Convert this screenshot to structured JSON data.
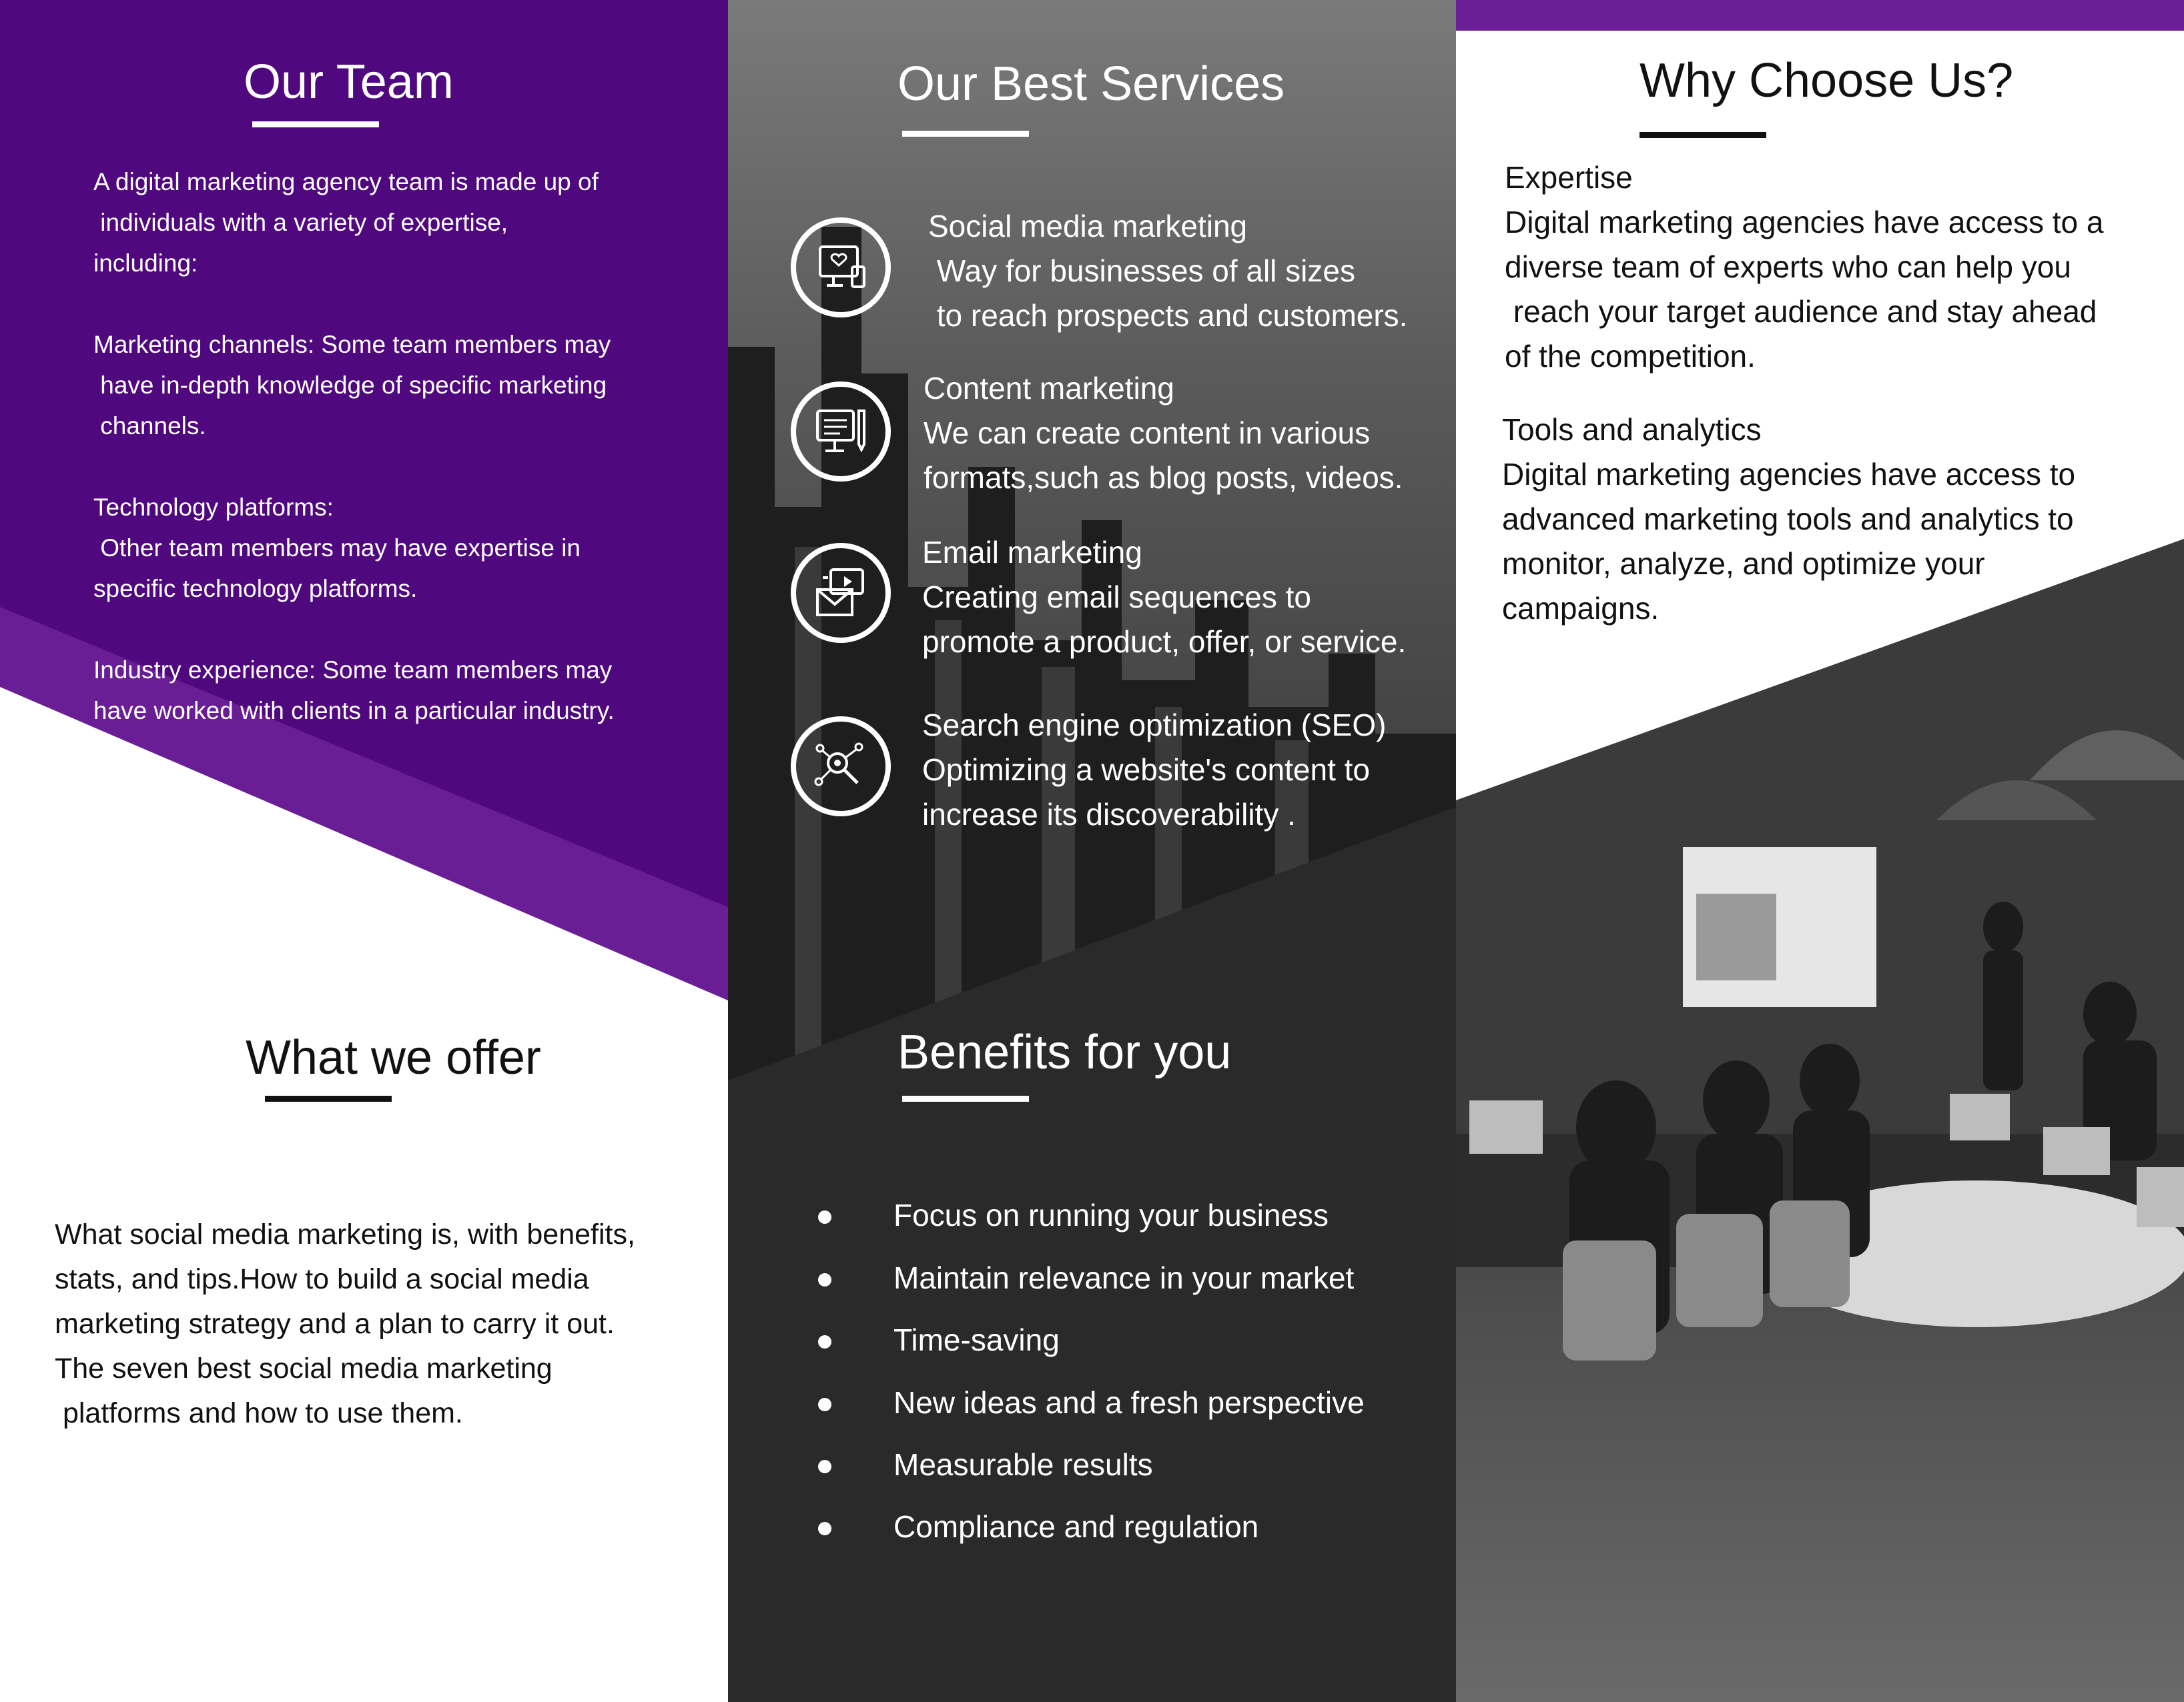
{
  "colors": {
    "purple_dark": "#4a0a7a",
    "purple_light": "#6a1e96",
    "dark_gray": "#2a2a2a",
    "accent_bar": "#6b1f96"
  },
  "team": {
    "title": "Our Team",
    "body": "A digital marketing agency team is made up of\n individuals with a variety of expertise,\nincluding:\n\nMarketing channels: Some team members may\n have in-depth knowledge of specific marketing\n channels.\n\nTechnology platforms:\n Other team members may have expertise in\nspecific technology platforms.\n\nIndustry experience: Some team members may\nhave worked with clients in a particular industry."
  },
  "offer": {
    "title": "What we offer",
    "body": "What social media marketing is, with benefits,\nstats, and tips.How to build a social media\nmarketing strategy and a plan to carry it out.\nThe seven best social media marketing\n platforms and how to use them."
  },
  "services": {
    "title": "Our Best Services",
    "items": [
      {
        "icon": "social-media-icon",
        "text": "Social media marketing\n Way for businesses of all sizes\n to reach prospects and customers."
      },
      {
        "icon": "content-marketing-icon",
        "text": "Content marketing\nWe can create content in various\nformats,such as blog posts, videos."
      },
      {
        "icon": "email-marketing-icon",
        "text": "Email marketing\nCreating email sequences to\npromote a product, offer, or service."
      },
      {
        "icon": "seo-icon",
        "text": "Search engine optimization (SEO)\nOptimizing a website's content to\nincrease its discoverability ."
      }
    ]
  },
  "benefits": {
    "title": "Benefits for you",
    "items": [
      "Focus on running your business",
      "Maintain relevance in your market",
      "Time-saving",
      "New ideas and a fresh perspective",
      "Measurable results",
      "Compliance and regulation"
    ]
  },
  "why": {
    "title": "Why Choose Us?",
    "expertise": "Expertise\nDigital marketing agencies have access to a\ndiverse team of experts who can help you\n reach your target audience and stay ahead\nof the competition.",
    "tools": "Tools and analytics\nDigital marketing agencies have access to\nadvanced marketing tools and analytics to\nmonitor, analyze, and optimize your\ncampaigns."
  }
}
